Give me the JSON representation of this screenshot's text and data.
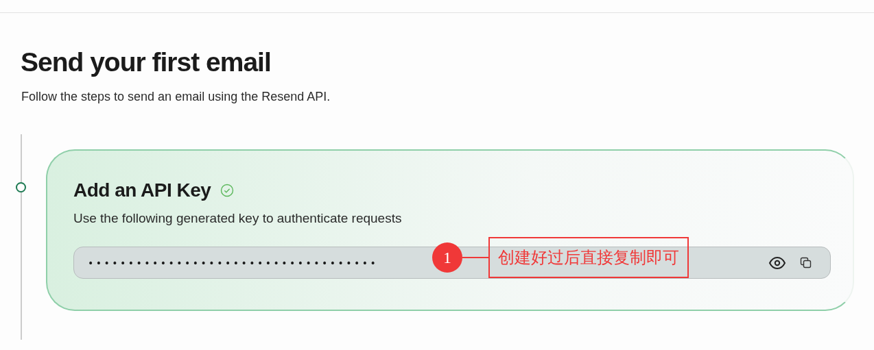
{
  "header": {
    "title": "Send your first email",
    "subtitle": "Follow the steps to send an email using the Resend API."
  },
  "steps": [
    {
      "title": "Add an API Key",
      "completed": true,
      "description": "Use the following generated key to authenticate requests",
      "key_value": "••••••••••••••••••••••••••••••••••••"
    }
  ],
  "annotation": {
    "number": "1",
    "text": "创建好过后直接复制即可"
  }
}
